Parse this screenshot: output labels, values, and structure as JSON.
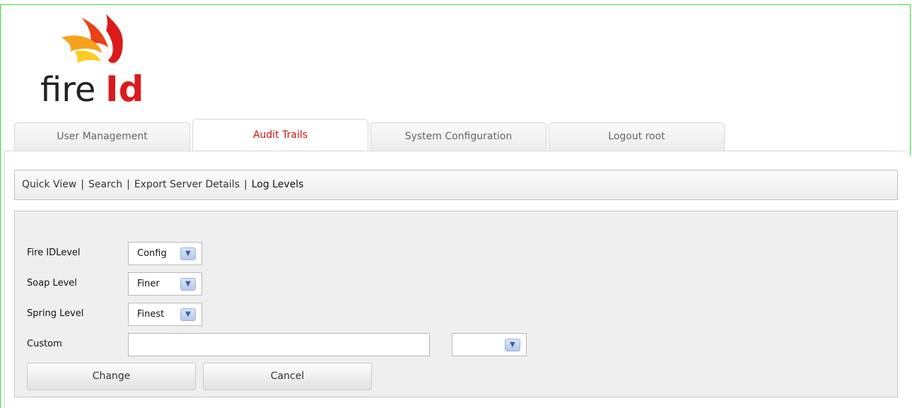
{
  "brand": {
    "logo_text_main": "fire",
    "logo_text_accent": "Id"
  },
  "tabs": [
    {
      "label": "User Management",
      "active": false
    },
    {
      "label": "Audit Trails",
      "active": true
    },
    {
      "label": "System Configuration",
      "active": false
    },
    {
      "label": "Logout root",
      "active": false
    }
  ],
  "subnav": {
    "items": [
      "Quick View",
      "Search",
      "Export Server Details",
      "Log Levels"
    ],
    "separator": "|",
    "current": "Log Levels"
  },
  "form": {
    "fireid_level": {
      "label": "Fire IDLevel",
      "value": "Config"
    },
    "soap_level": {
      "label": "Soap Level",
      "value": "Finer"
    },
    "spring_level": {
      "label": "Spring Level",
      "value": "Finest"
    },
    "custom": {
      "label": "Custom",
      "value": "",
      "level_value": ""
    },
    "change_label": "Change",
    "cancel_label": "Cancel"
  },
  "colors": {
    "active_tab_text": "#cc1111",
    "frame_border": "#33dd33",
    "logo_red": "#dd1a1a",
    "logo_orange": "#f7a21b",
    "logo_yellow": "#ffcc22"
  }
}
